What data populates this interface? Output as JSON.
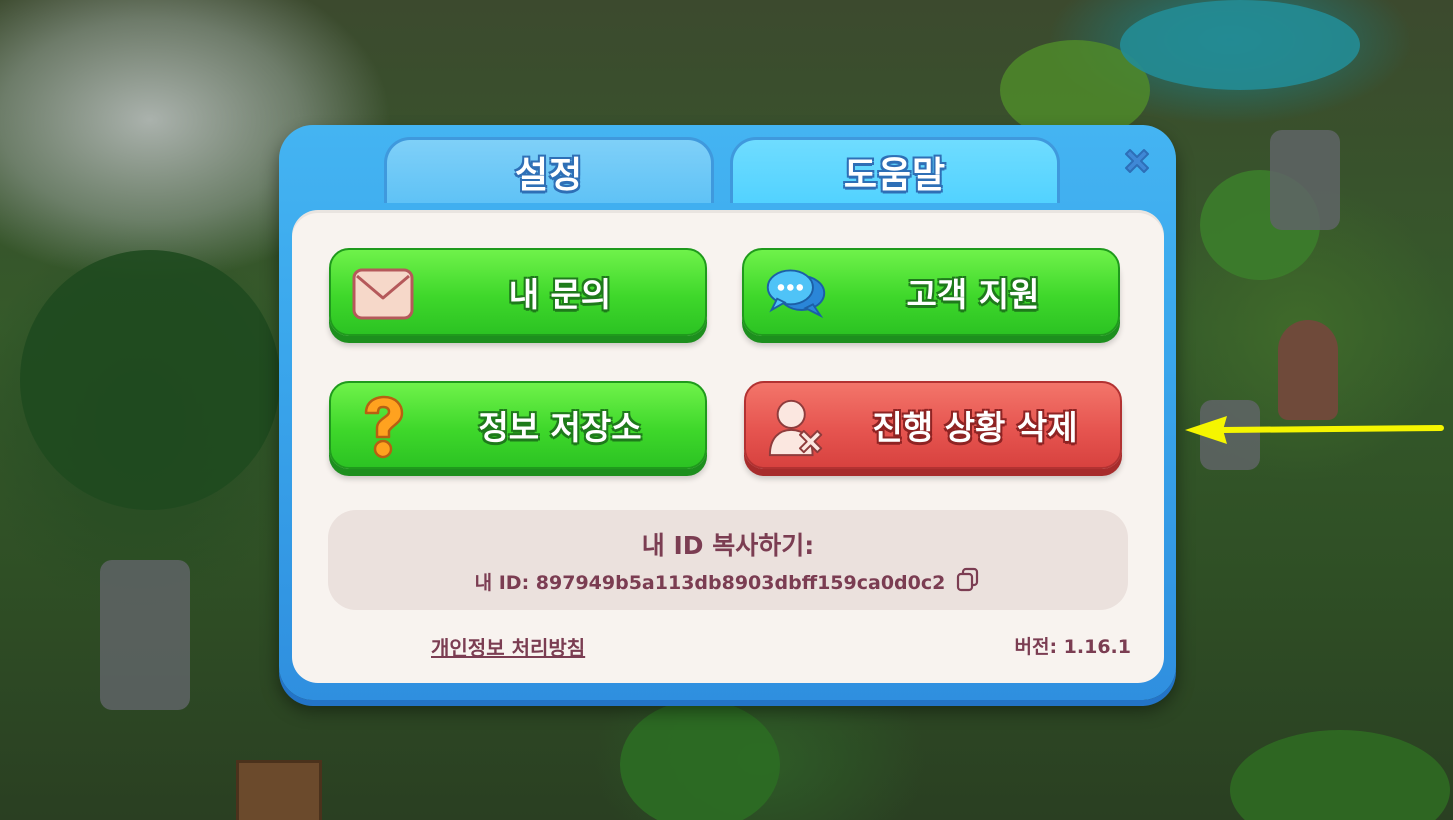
{
  "tabs": [
    {
      "label": "설정",
      "active": false
    },
    {
      "label": "도움말",
      "active": true
    }
  ],
  "icons": {
    "close": "close-icon",
    "inquiry": "envelope-icon",
    "support": "chat-bubbles-icon",
    "info": "question-mark-icon",
    "delete": "user-delete-icon",
    "copy": "copy-icon"
  },
  "buttons": {
    "my_inquiry": "내 문의",
    "customer_support": "고객 지원",
    "info_storage": "정보 저장소",
    "delete_progress": "진행 상황 삭제"
  },
  "id_box": {
    "title": "내 ID 복사하기:",
    "id_line": "내 ID: 897949b5a113db8903dbff159ca0d0c2"
  },
  "footer": {
    "privacy_link": "개인정보 처리방침",
    "version": "버전: 1.16.1"
  },
  "colors": {
    "dialog_blue": "#3aa6ec",
    "green_button": "#3fd82b",
    "red_button": "#e65550",
    "text_maroon": "#7b3d52",
    "arrow_yellow": "#f5f500"
  }
}
